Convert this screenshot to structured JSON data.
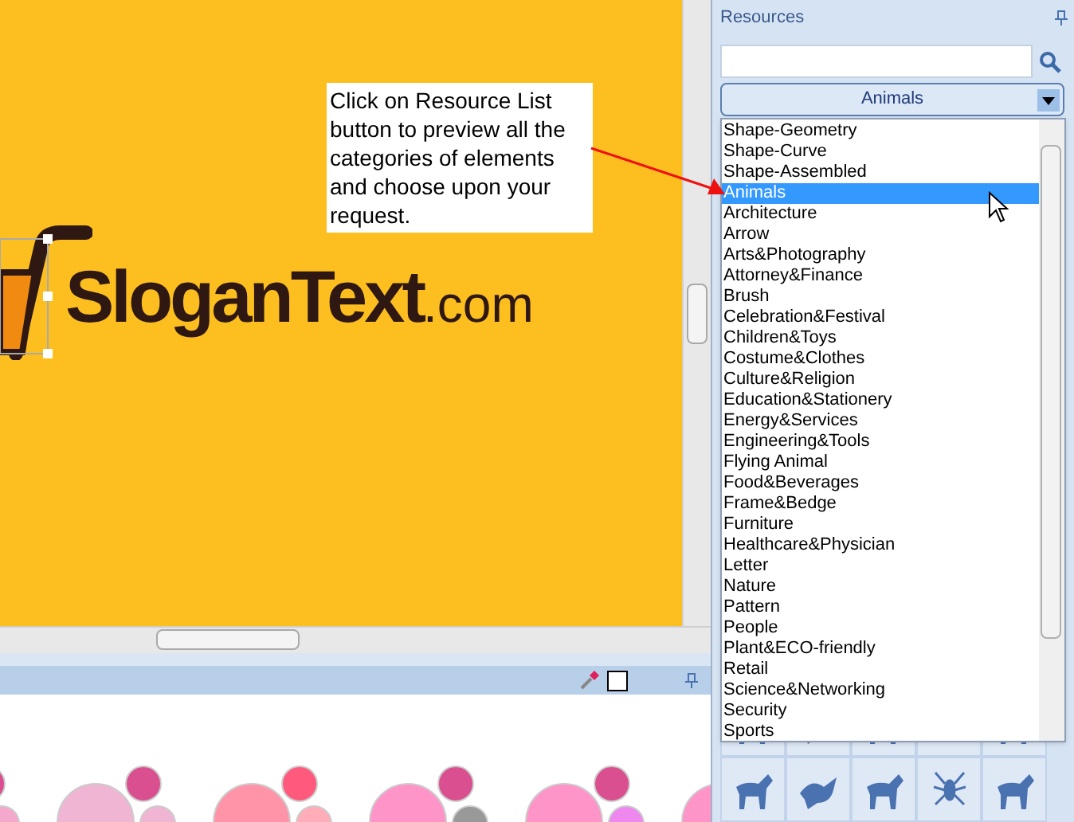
{
  "canvas": {
    "callout": "Click on Resource List button to preview all the categories of elements and choose upon your request.",
    "logo": {
      "name": "SloganText",
      "suffix": ".com"
    }
  },
  "color_panel": {
    "schemes": [
      {
        "circles": [
          {
            "kind": "top",
            "color": "#d94f8f"
          },
          {
            "kind": "bottom",
            "color": "#f4a8cc"
          }
        ]
      },
      {
        "circles": [
          {
            "kind": "large",
            "color": "#f0b5d2"
          },
          {
            "kind": "top",
            "color": "#d94f8f"
          },
          {
            "kind": "bottom",
            "color": "#f0b5d2"
          }
        ]
      },
      {
        "circles": [
          {
            "kind": "large",
            "color": "#ff94a8"
          },
          {
            "kind": "top",
            "color": "#ff5a7e"
          },
          {
            "kind": "bottom",
            "color": "#ffadb8"
          }
        ]
      },
      {
        "circles": [
          {
            "kind": "large",
            "color": "#ff94c8"
          },
          {
            "kind": "top",
            "color": "#d94f8f"
          },
          {
            "kind": "bottom",
            "color": "#999999"
          }
        ]
      },
      {
        "circles": [
          {
            "kind": "large",
            "color": "#ff94c8"
          },
          {
            "kind": "top",
            "color": "#d94f8f"
          },
          {
            "kind": "bottom",
            "color": "#ee88ee"
          }
        ]
      },
      {
        "circles": [
          {
            "kind": "large",
            "color": "#ff94c8"
          }
        ]
      }
    ]
  },
  "resources": {
    "title": "Resources",
    "category_button": "Animals",
    "categories": [
      {
        "label": "Shape-Geometry",
        "selected": false
      },
      {
        "label": "Shape-Curve",
        "selected": false
      },
      {
        "label": "Shape-Assembled",
        "selected": false
      },
      {
        "label": "Animals",
        "selected": true
      },
      {
        "label": "Architecture",
        "selected": false
      },
      {
        "label": "Arrow",
        "selected": false
      },
      {
        "label": "Arts&Photography",
        "selected": false
      },
      {
        "label": "Attorney&Finance",
        "selected": false
      },
      {
        "label": "Brush",
        "selected": false
      },
      {
        "label": "Celebration&Festival",
        "selected": false
      },
      {
        "label": "Children&Toys",
        "selected": false
      },
      {
        "label": "Costume&Clothes",
        "selected": false
      },
      {
        "label": "Culture&Religion",
        "selected": false
      },
      {
        "label": "Education&Stationery",
        "selected": false
      },
      {
        "label": "Energy&Services",
        "selected": false
      },
      {
        "label": "Engineering&Tools",
        "selected": false
      },
      {
        "label": "Flying Animal",
        "selected": false
      },
      {
        "label": "Food&Beverages",
        "selected": false
      },
      {
        "label": "Frame&Bedge",
        "selected": false
      },
      {
        "label": "Furniture",
        "selected": false
      },
      {
        "label": "Healthcare&Physician",
        "selected": false
      },
      {
        "label": "Letter",
        "selected": false
      },
      {
        "label": "Nature",
        "selected": false
      },
      {
        "label": "Pattern",
        "selected": false
      },
      {
        "label": "People",
        "selected": false
      },
      {
        "label": "Plant&ECO-friendly",
        "selected": false
      },
      {
        "label": "Retail",
        "selected": false
      },
      {
        "label": "Science&Networking",
        "selected": false
      },
      {
        "label": "Security",
        "selected": false
      },
      {
        "label": "Sports",
        "selected": false
      }
    ]
  }
}
